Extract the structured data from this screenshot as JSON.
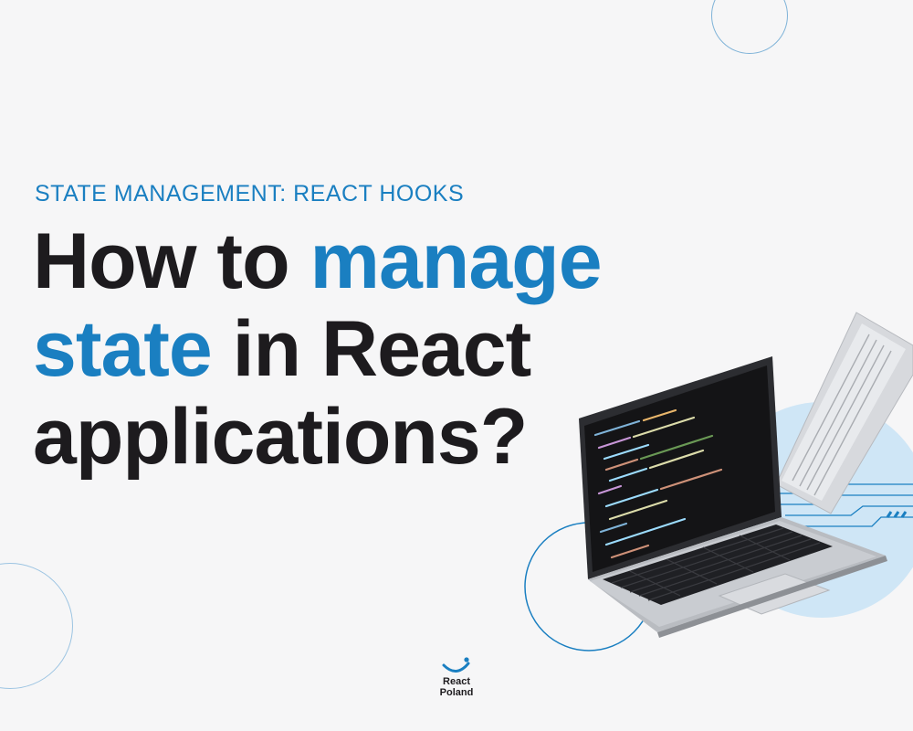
{
  "eyebrow": "STATE MANAGEMENT: REACT HOOKS",
  "headline": {
    "line1_plain": "How to ",
    "line1_accent": "manage",
    "line2_accent": "state",
    "line2_plain": " in React",
    "line3_plain": "applications?"
  },
  "logo": {
    "line1": "React",
    "line2": "Poland"
  },
  "colors": {
    "accent": "#1a7fc1",
    "text": "#1d1b1e",
    "background": "#f6f6f7",
    "light_blue": "#cfe6f6"
  },
  "icons": [
    "laptop-illustration",
    "react-poland-logo"
  ]
}
